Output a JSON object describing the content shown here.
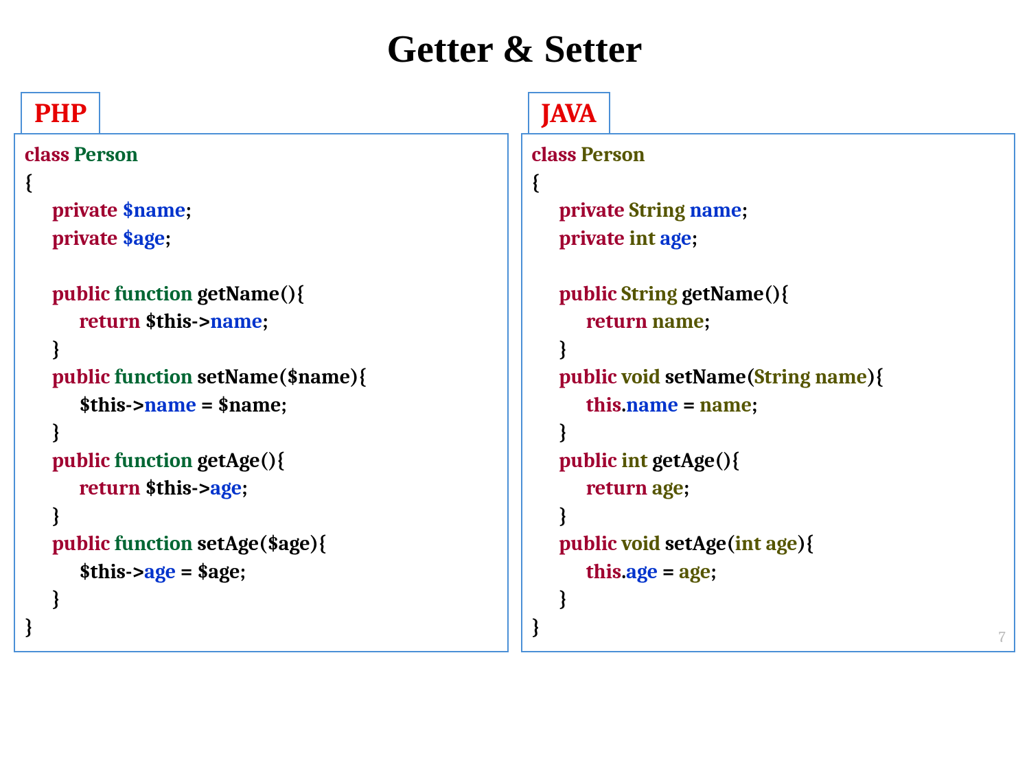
{
  "title": "Getter & Setter",
  "page_number": "7",
  "php": {
    "label": "PHP",
    "t": {
      "l1a": "class",
      "l1b": " Person",
      "l2": "{",
      "l3a": "      private ",
      "l3b": "$name",
      "l3c": ";",
      "l4a": "      private ",
      "l4b": "$age",
      "l4c": ";",
      "l6a": "      public ",
      "l6b": "function ",
      "l6c": "getName(){",
      "l7a": "            return ",
      "l7b": "$this->",
      "l7c": "name",
      "l7d": ";",
      "l8": "      }",
      "l9a": "      public ",
      "l9b": "function ",
      "l9c": "setName($name){",
      "l10a": "            $this->",
      "l10b": "name",
      "l10c": " = $name;",
      "l11": "      }",
      "l12a": "      public ",
      "l12b": "function ",
      "l12c": "getAge(){",
      "l13a": "            return ",
      "l13b": "$this->",
      "l13c": "age",
      "l13d": ";",
      "l14": "      }",
      "l15a": "      public ",
      "l15b": "function ",
      "l15c": "setAge($age){",
      "l16a": "            $this->",
      "l16b": "age",
      "l16c": " = $age;",
      "l17": "      }",
      "l18": "}"
    }
  },
  "java": {
    "label": "JAVA",
    "t": {
      "l1a": "class ",
      "l1b": "Person",
      "l2": "{",
      "l3a": "      private ",
      "l3b": "String ",
      "l3c": "name",
      "l3d": ";",
      "l4a": "      private ",
      "l4b": "int ",
      "l4c": "age",
      "l4d": ";",
      "l6a": "      public ",
      "l6b": "String ",
      "l6c": "getName(){",
      "l7a": "            return ",
      "l7b": "name",
      "l7c": ";",
      "l8": "      }",
      "l9a": "      public ",
      "l9b": "void ",
      "l9c": "setName(",
      "l9d": "String ",
      "l9e": "name",
      "l9f": "){",
      "l10a": "            this",
      "l10b": ".",
      "l10c": "name",
      "l10d": " = ",
      "l10e": "name",
      "l10f": ";",
      "l11": "      }",
      "l12a": "      public ",
      "l12b": "int ",
      "l12c": "getAge(){",
      "l13a": "            return ",
      "l13b": "age",
      "l13c": ";",
      "l14": "      }",
      "l15a": "      public ",
      "l15b": "void ",
      "l15c": "setAge(",
      "l15d": "int ",
      "l15e": "age",
      "l15f": "){",
      "l16a": "            this",
      "l16b": ".",
      "l16c": "age",
      "l16d": " = ",
      "l16e": "age",
      "l16f": ";",
      "l17": "      }",
      "l18": "}"
    }
  }
}
